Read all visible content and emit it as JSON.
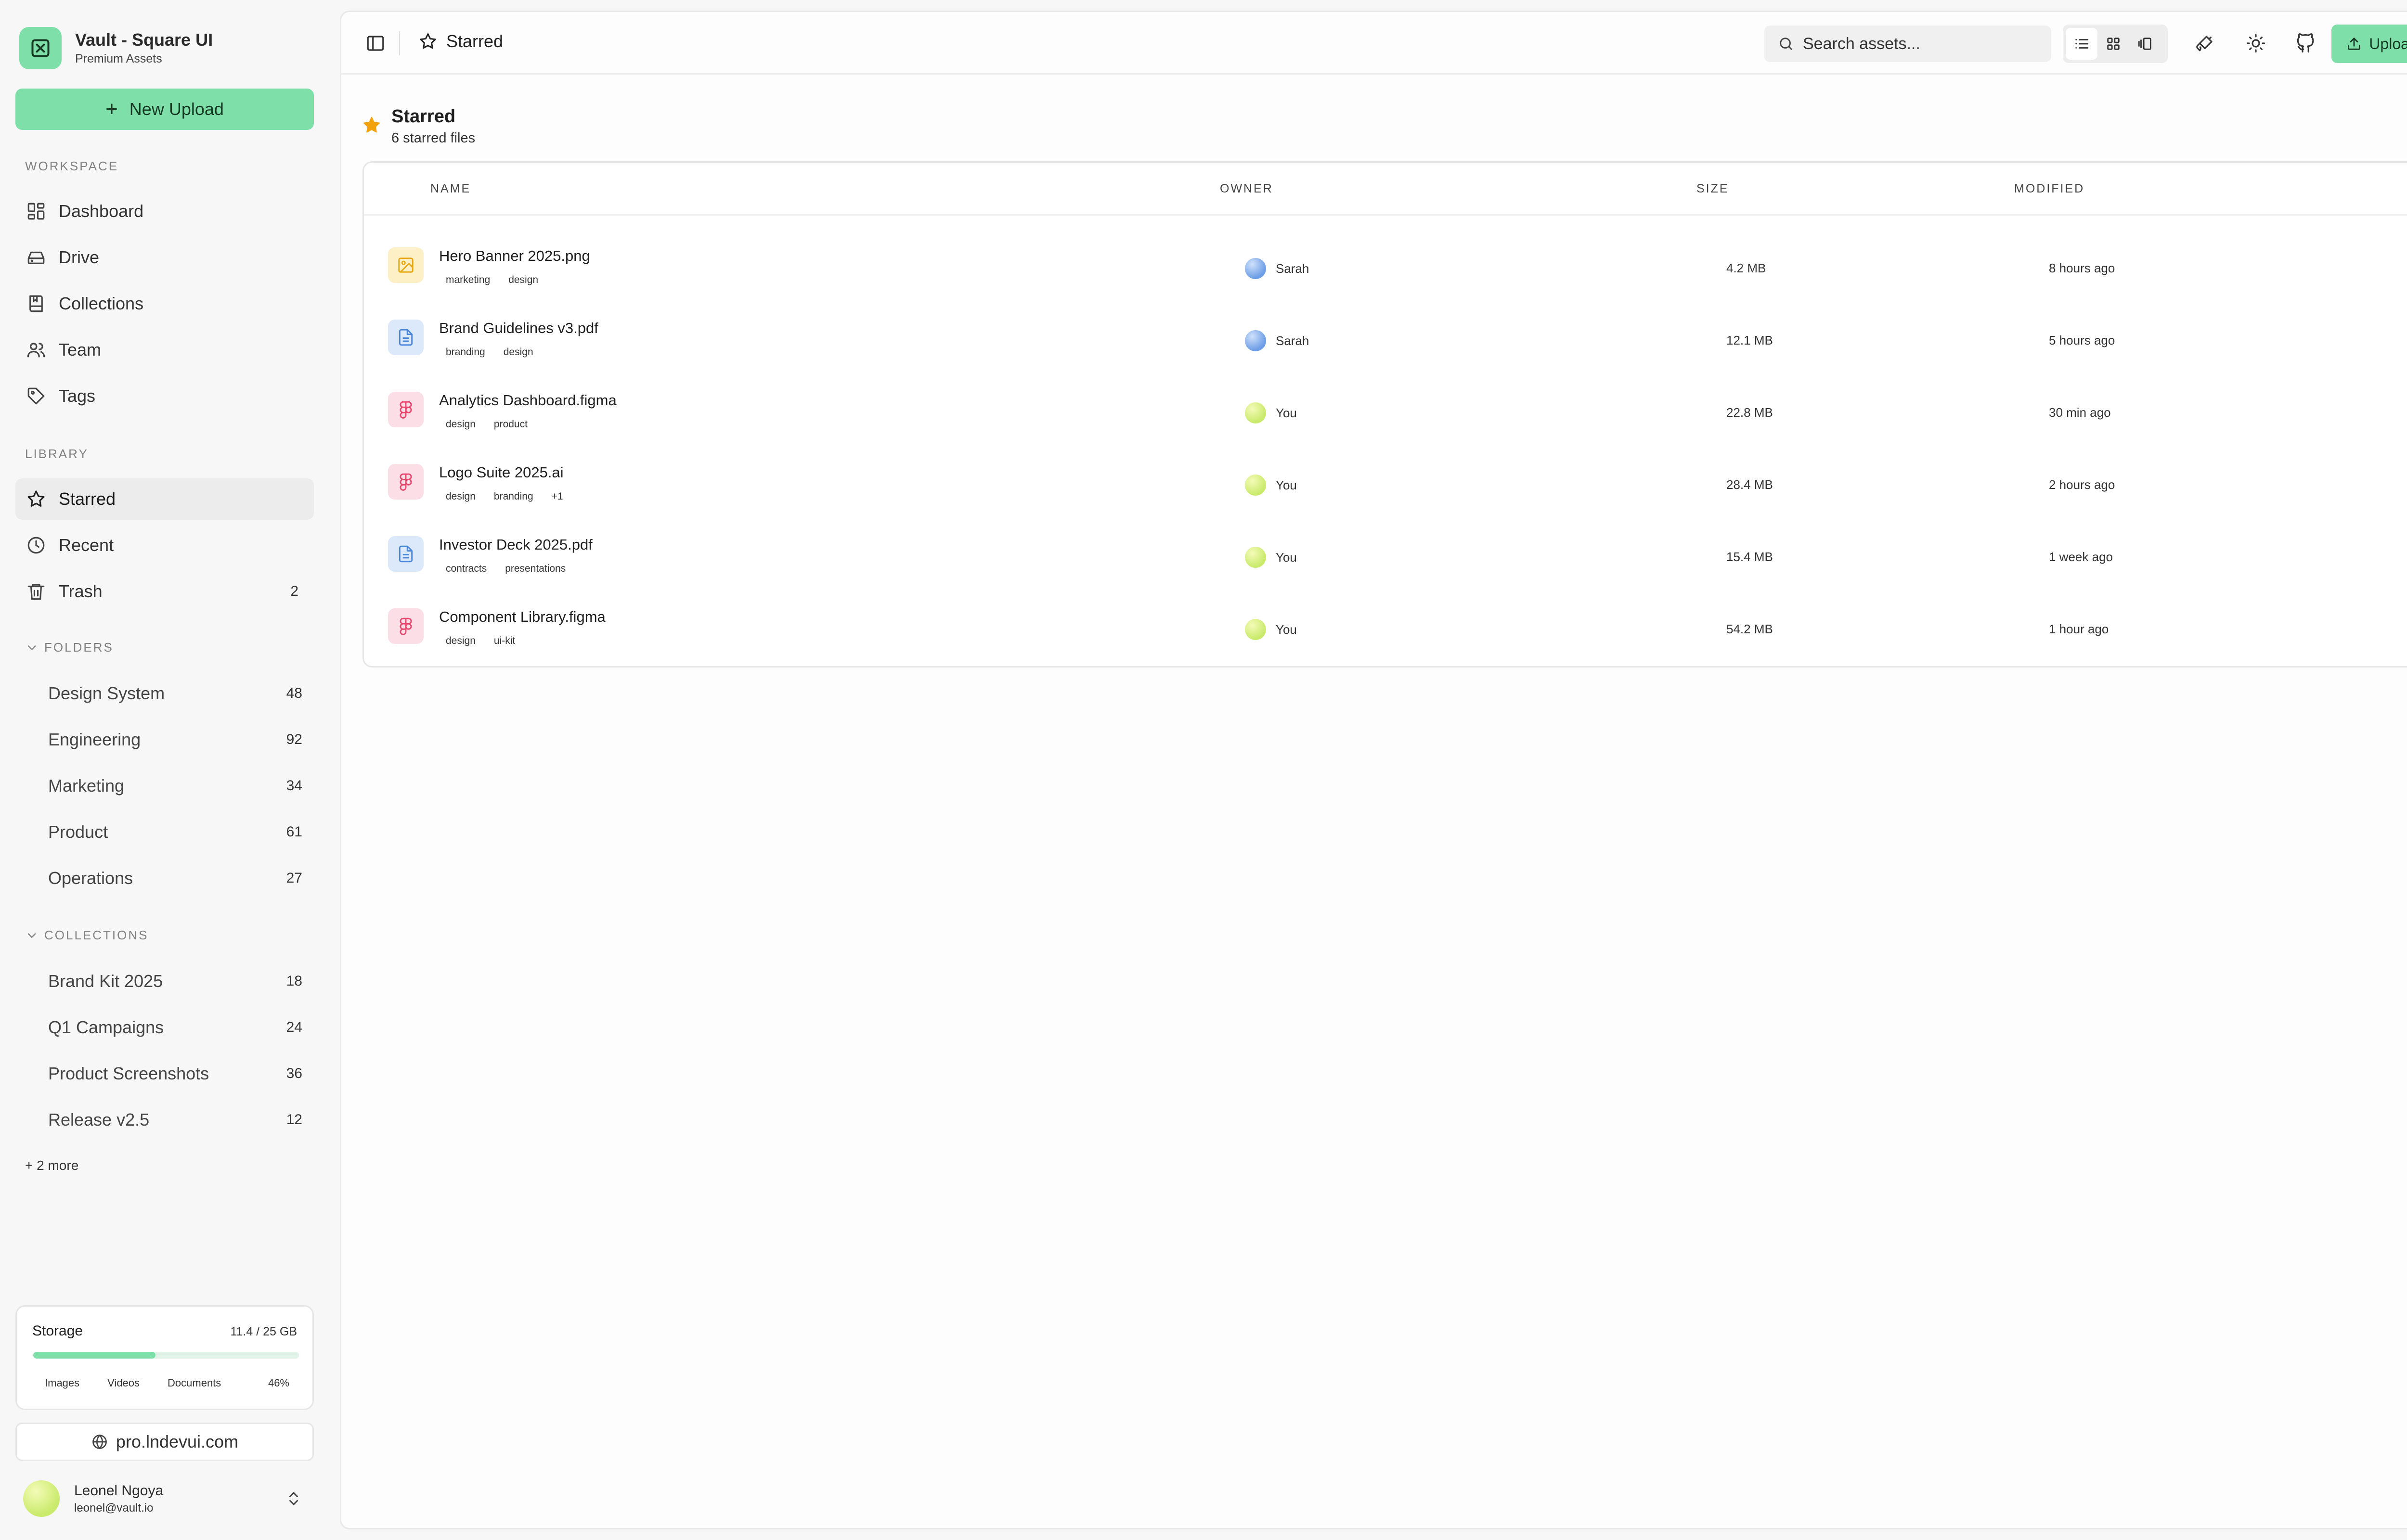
{
  "brand": {
    "name": "Vault - Square UI",
    "subtitle": "Premium Assets"
  },
  "sidebar": {
    "new_upload_label": "New Upload",
    "workspace_label": "WORKSPACE",
    "workspace_items": [
      {
        "label": "Dashboard",
        "icon": "dashboard-icon"
      },
      {
        "label": "Drive",
        "icon": "drive-icon"
      },
      {
        "label": "Collections",
        "icon": "collections-icon"
      },
      {
        "label": "Team",
        "icon": "team-icon"
      },
      {
        "label": "Tags",
        "icon": "tag-icon"
      }
    ],
    "library_label": "LIBRARY",
    "library_items": [
      {
        "label": "Starred",
        "icon": "star-icon",
        "active": true
      },
      {
        "label": "Recent",
        "icon": "clock-icon"
      },
      {
        "label": "Trash",
        "icon": "trash-icon",
        "count": "2"
      }
    ],
    "folders_label": "FOLDERS",
    "folders": [
      {
        "label": "Design System",
        "count": "48"
      },
      {
        "label": "Engineering",
        "count": "92"
      },
      {
        "label": "Marketing",
        "count": "34"
      },
      {
        "label": "Product",
        "count": "61"
      },
      {
        "label": "Operations",
        "count": "27"
      }
    ],
    "collections_label": "COLLECTIONS",
    "collections": [
      {
        "label": "Brand Kit 2025",
        "count": "18"
      },
      {
        "label": "Q1 Campaigns",
        "count": "24"
      },
      {
        "label": "Product Screenshots",
        "count": "36"
      },
      {
        "label": "Release v2.5",
        "count": "12"
      }
    ],
    "more_label": "+ 2 more",
    "storage": {
      "title": "Storage",
      "value": "11.4 / 25 GB",
      "fill_fraction": 0.46,
      "legend": [
        "Images",
        "Videos",
        "Documents"
      ],
      "percent": "46%"
    },
    "site_link": "pro.lndevui.com",
    "user": {
      "name": "Leonel Ngoya",
      "email": "leonel@vault.io"
    }
  },
  "topbar": {
    "title": "Starred",
    "search_placeholder": "Search assets...",
    "upload_label": "Upload"
  },
  "page": {
    "title": "Starred",
    "subtitle": "6 starred files"
  },
  "table": {
    "headers": {
      "name": "NAME",
      "owner": "OWNER",
      "size": "SIZE",
      "modified": "MODIFIED"
    },
    "rows": [
      {
        "name": "Hero Banner 2025.png",
        "type": "image",
        "tags": [
          "marketing",
          "design"
        ],
        "owner": "Sarah",
        "size": "4.2 MB",
        "modified": "8 hours ago"
      },
      {
        "name": "Brand Guidelines v3.pdf",
        "type": "document",
        "tags": [
          "branding",
          "design"
        ],
        "owner": "Sarah",
        "size": "12.1 MB",
        "modified": "5 hours ago"
      },
      {
        "name": "Analytics Dashboard.figma",
        "type": "figma",
        "tags": [
          "design",
          "product"
        ],
        "owner": "You",
        "size": "22.8 MB",
        "modified": "30 min ago"
      },
      {
        "name": "Logo Suite 2025.ai",
        "type": "figma",
        "tags": [
          "design",
          "branding",
          "+1"
        ],
        "owner": "You",
        "size": "28.4 MB",
        "modified": "2 hours ago"
      },
      {
        "name": "Investor Deck 2025.pdf",
        "type": "document",
        "tags": [
          "contracts",
          "presentations"
        ],
        "owner": "You",
        "size": "15.4 MB",
        "modified": "1 week ago"
      },
      {
        "name": "Component Library.figma",
        "type": "figma",
        "tags": [
          "design",
          "ui-kit"
        ],
        "owner": "You",
        "size": "54.2 MB",
        "modified": "1 hour ago"
      }
    ]
  },
  "colors": {
    "accent": "#7ee0a8",
    "star": "#f2a20c",
    "figma": "#e8486e",
    "doc": "#4a86d8",
    "image": "#e8a814"
  }
}
